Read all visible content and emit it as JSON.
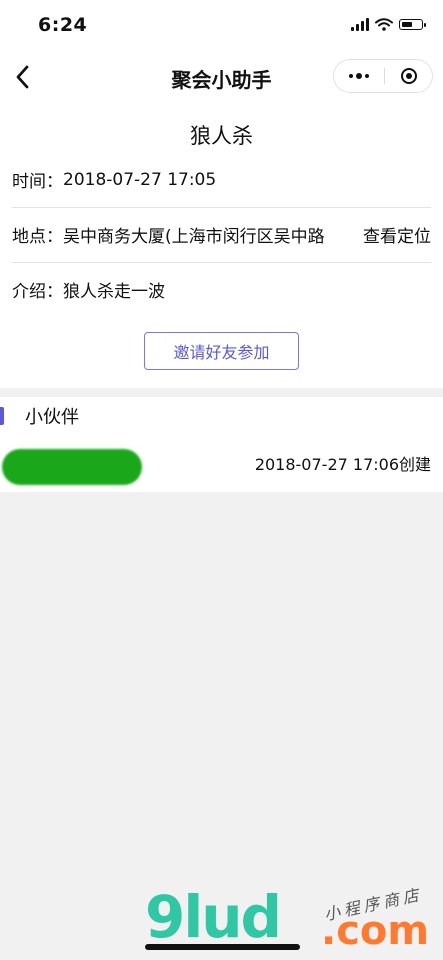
{
  "status_bar": {
    "time": "6:24"
  },
  "nav": {
    "title": "聚会小助手"
  },
  "event": {
    "title": "狼人杀",
    "time_label": "时间：",
    "time_value": "2018-07-27 17:05",
    "place_label": "地点：",
    "place_value": "吴中商务大厦(上海市闵行区吴中路",
    "locate_label": "查看定位",
    "intro_label": "介绍：",
    "intro_value": "狼人杀走一波",
    "invite_label": "邀请好友参加"
  },
  "friends": {
    "section_title": "小伙伴",
    "members": [
      {
        "created": "2018-07-27 17:06创建"
      }
    ]
  },
  "watermark": {
    "logo": "9lud",
    "suffix": ".com",
    "tagline": "小程序商店"
  },
  "colors": {
    "accent": "#5b59d6",
    "avatar_blur": "#1aa81a"
  }
}
